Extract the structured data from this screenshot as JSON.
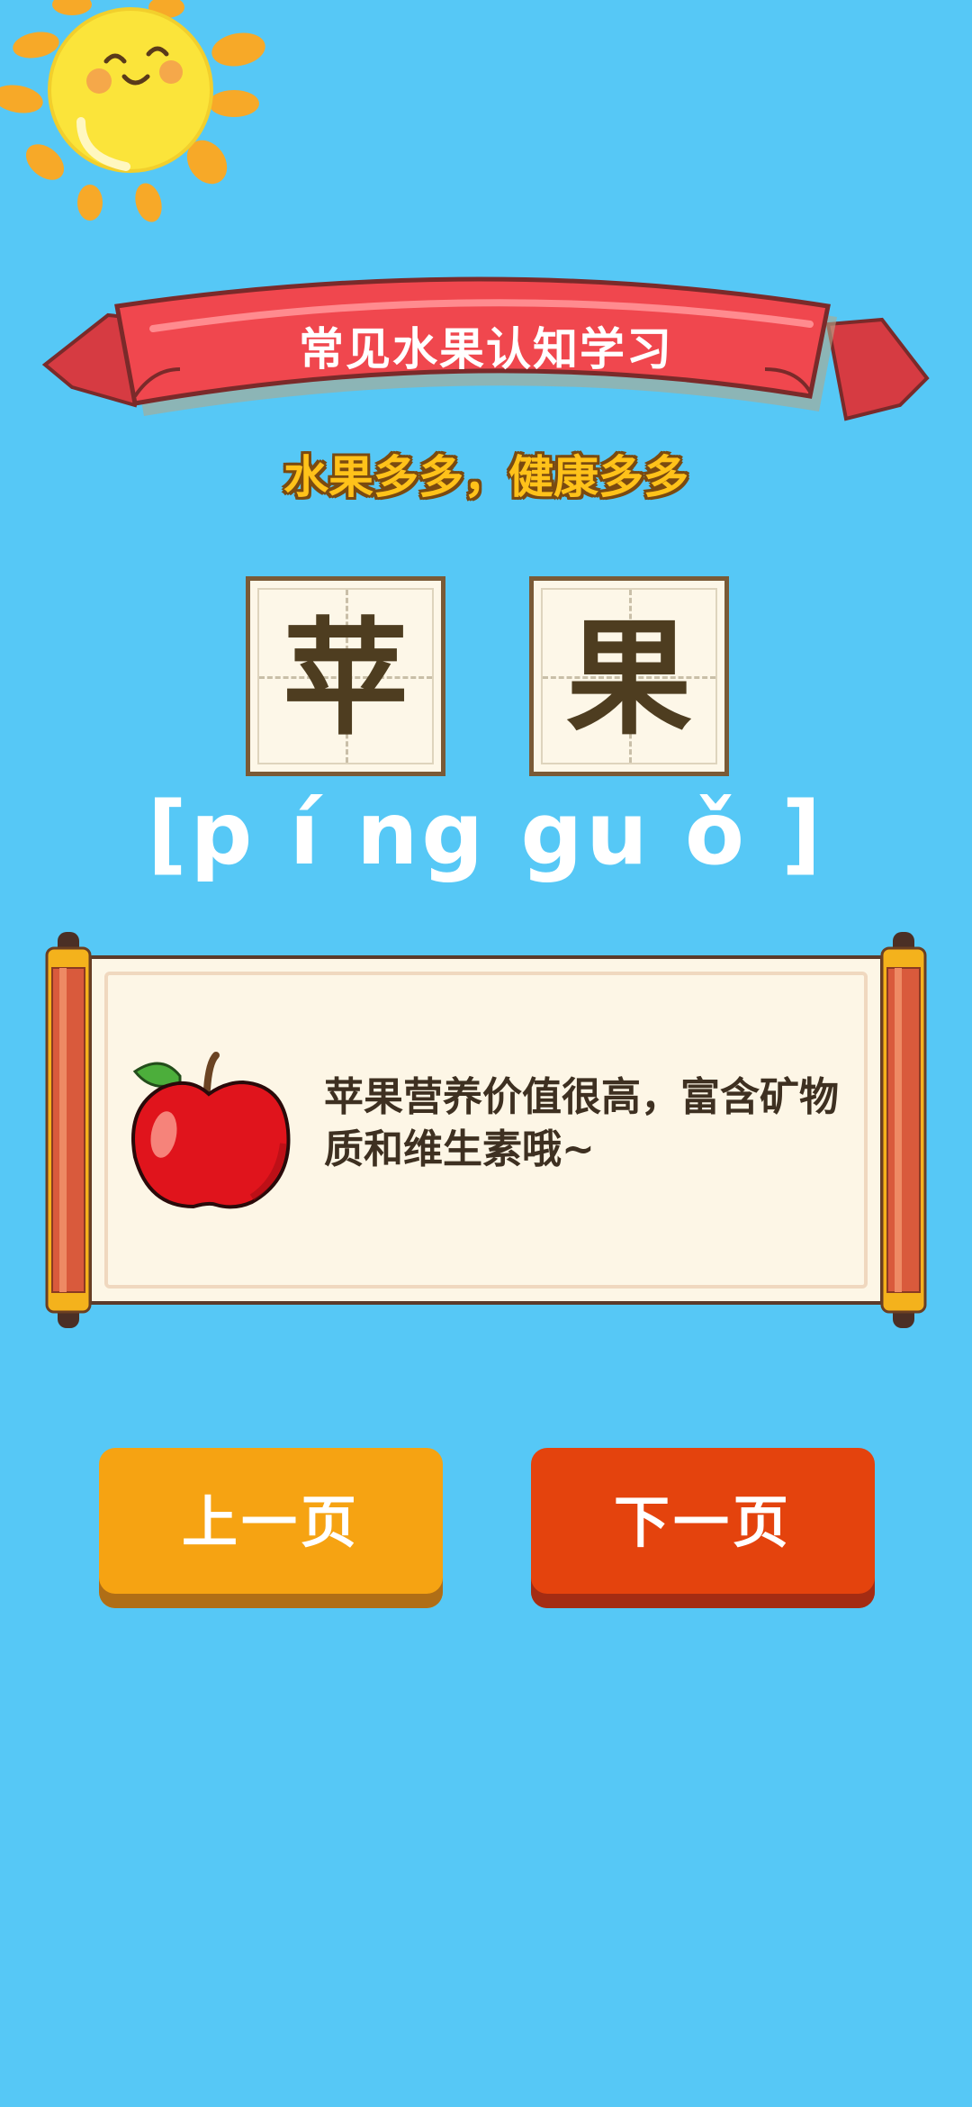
{
  "header": {
    "banner_title": "常见水果认知学习",
    "subtitle": "水果多多，健康多多"
  },
  "word": {
    "characters": [
      "苹",
      "果"
    ],
    "pinyin": "[p í ng gu ǒ ]"
  },
  "card": {
    "description": "苹果营养价值很高，富含矿物质和维生素哦~",
    "image_icon": "apple-icon"
  },
  "buttons": {
    "prev_label": "上一页",
    "next_label": "下一页"
  },
  "colors": {
    "background": "#56c8f6",
    "banner_red": "#f0474e",
    "prev_button": "#f6a312",
    "next_button": "#e4430d",
    "subtitle_yellow": "#ffc21a"
  }
}
